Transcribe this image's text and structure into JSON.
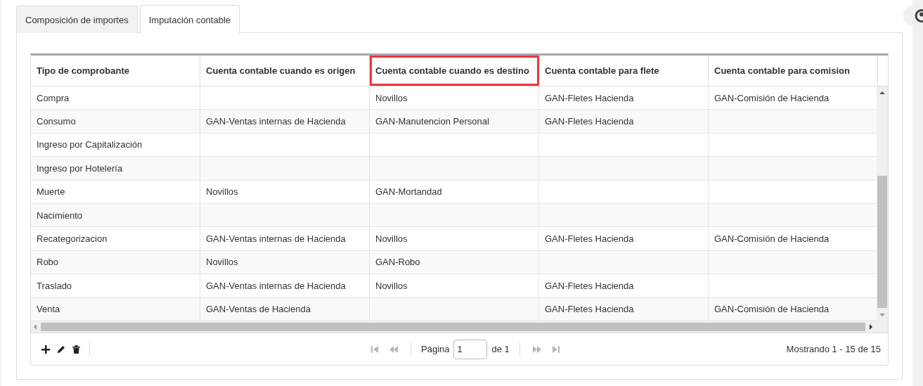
{
  "tabs": [
    {
      "label": "Composición de importes",
      "selected": false
    },
    {
      "label": "Imputación contable",
      "selected": true
    }
  ],
  "table": {
    "columns": [
      {
        "label": "Tipo de comprobante",
        "highlighted": false
      },
      {
        "label": "Cuenta contable cuando es origen",
        "highlighted": false
      },
      {
        "label": "Cuenta contable cuando es destino",
        "highlighted": true
      },
      {
        "label": "Cuenta contable para flete",
        "highlighted": false
      },
      {
        "label": "Cuenta contable para comision",
        "highlighted": false
      }
    ],
    "rows": [
      [
        "Compra",
        "",
        "Novillos",
        "GAN-Fletes Hacienda",
        "GAN-Comisión de Hacienda"
      ],
      [
        "Consumo",
        "GAN-Ventas internas de Hacienda",
        "GAN-Manutencion Personal",
        "GAN-Fletes Hacienda",
        ""
      ],
      [
        "Ingreso por Capitalización",
        "",
        "",
        "",
        ""
      ],
      [
        "Ingreso por Hotelería",
        "",
        "",
        "",
        ""
      ],
      [
        "Muerte",
        "Novillos",
        "GAN-Mortandad",
        "",
        ""
      ],
      [
        "Nacimiento",
        "",
        "",
        "",
        ""
      ],
      [
        "Recategorizacion",
        "GAN-Ventas internas de Hacienda",
        "Novillos",
        "GAN-Fletes Hacienda",
        "GAN-Comisión de Hacienda"
      ],
      [
        "Robo",
        "Novillos",
        "GAN-Robo",
        "",
        ""
      ],
      [
        "Traslado",
        "GAN-Ventas internas de Hacienda",
        "Novillos",
        "GAN-Fletes Hacienda",
        ""
      ],
      [
        "Venta",
        "GAN-Ventas de Hacienda",
        "",
        "GAN-Fletes Hacienda",
        "GAN-Comisión de Hacienda"
      ]
    ]
  },
  "pager": {
    "page_label": "Página",
    "page": "1",
    "of_label": "de 1",
    "summary": "Mostrando 1 - 15 de 15"
  }
}
